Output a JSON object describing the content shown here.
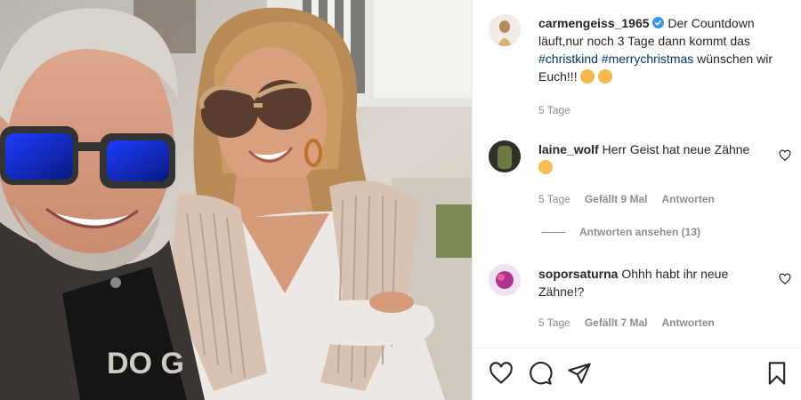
{
  "caption": {
    "username": "carmengeiss_1965",
    "text_before": " Der Countdown läuft,nur noch 3 Tage dann kommt das ",
    "tag1": "#christkind",
    "tag2": "#merrychristmas",
    "text_after": " wünschen wir Euch!!! ",
    "time": "5 Tage"
  },
  "comments": [
    {
      "username": "laine_wolf",
      "text": " Herr Geist hat neue Zähne ",
      "time": "5 Tage",
      "likes": "Gefällt 9 Mal",
      "reply": "Antworten",
      "view_replies": "Antworten ansehen (13)"
    },
    {
      "username": "soporsaturna",
      "text": " Ohhh habt ihr neue Zähne!?",
      "time": "5 Tage",
      "likes": "Gefällt 7 Mal",
      "reply": "Antworten"
    }
  ],
  "icons": [
    "verified-badge-icon",
    "heart-icon",
    "comment-icon",
    "share-icon",
    "bookmark-icon"
  ],
  "colors": {
    "verified": "#3897f0",
    "hashtag": "#00376b",
    "meta": "#8e8e8e"
  }
}
